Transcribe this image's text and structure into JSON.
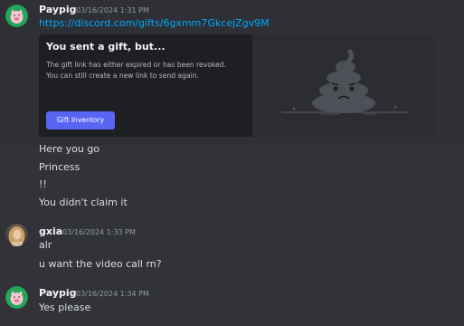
{
  "messages": [
    {
      "author": "Paypig",
      "timestamp": "03/16/2024 1:31 PM",
      "link": "https://discord.com/gifts/6gxmm7GkcejZgv9M",
      "gift_card": {
        "title": "You sent a gift, but...",
        "body_line1": "The gift link has either expired or has been revoked.",
        "body_line2": "You can still create a new link to send again.",
        "button_label": "Gift Inventory",
        "art_icon": "sad-poop-icon"
      },
      "lines": [
        "Here you go",
        "Princess",
        "!!",
        "You didn't claim it"
      ]
    },
    {
      "author": "gxia",
      "timestamp": "03/16/2024 1:33 PM",
      "lines": [
        "alr",
        "u want the video call rn?"
      ]
    },
    {
      "author": "Paypig",
      "timestamp": "03/16/2024 1:34 PM",
      "lines": [
        "Yes please"
      ]
    }
  ],
  "colors": {
    "background": "#313338",
    "link": "#00a8fc",
    "button": "#5865f2",
    "paypig_avatar": "#23a55a"
  },
  "icons": {
    "paypig_avatar": "pig-avatar-icon",
    "gxia_avatar": "user-photo-avatar"
  }
}
